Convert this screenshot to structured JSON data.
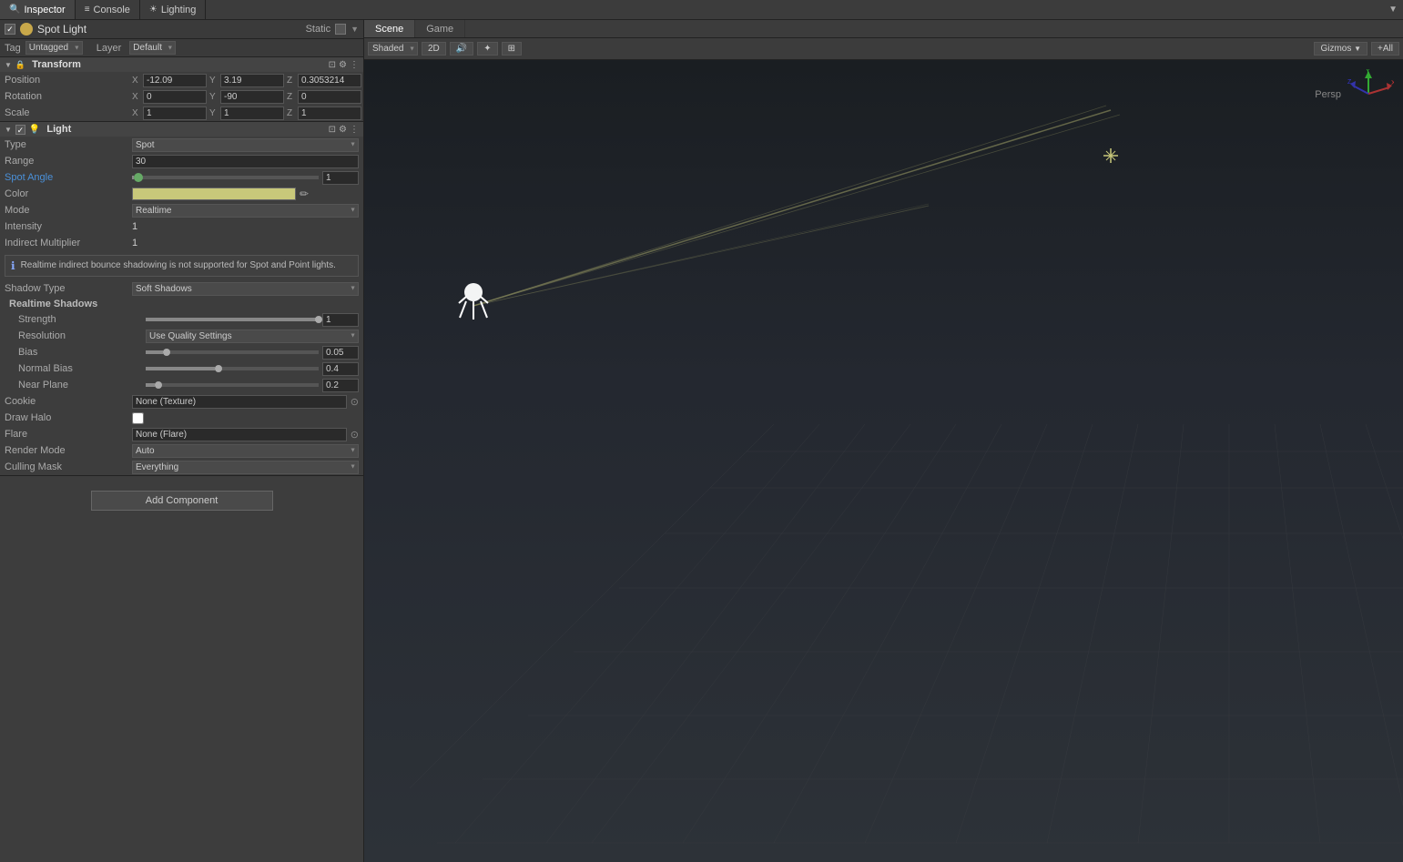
{
  "inspector_tab": "Inspector",
  "console_tab": "Console",
  "lighting_tab": "Lighting",
  "object": {
    "name": "Spot Light",
    "static_label": "Static",
    "tag": "Untagged",
    "layer": "Default"
  },
  "transform": {
    "title": "Transform",
    "position_label": "Position",
    "pos_x": "-12.09",
    "pos_y": "3.19",
    "pos_z": "0.3053214",
    "rotation_label": "Rotation",
    "rot_x": "0",
    "rot_y": "-90",
    "rot_z": "0",
    "scale_label": "Scale",
    "scale_x": "1",
    "scale_y": "1",
    "scale_z": "1"
  },
  "light": {
    "title": "Light",
    "type_label": "Type",
    "type_value": "Spot",
    "range_label": "Range",
    "range_value": "30",
    "spot_angle_label": "Spot Angle",
    "spot_angle_value": "1",
    "color_label": "Color",
    "mode_label": "Mode",
    "mode_value": "Realtime",
    "intensity_label": "Intensity",
    "intensity_value": "1",
    "indirect_mult_label": "Indirect Multiplier",
    "indirect_mult_value": "1",
    "info_text": "Realtime indirect bounce shadowing is not supported for Spot and Point lights.",
    "shadow_type_label": "Shadow Type",
    "shadow_type_value": "Soft Shadows",
    "realtime_shadows_label": "Realtime Shadows",
    "strength_label": "Strength",
    "strength_value": "1",
    "strength_pct": 100,
    "resolution_label": "Resolution",
    "resolution_value": "Use Quality Settings",
    "bias_label": "Bias",
    "bias_value": "0.05",
    "bias_pct": 10,
    "normal_bias_label": "Normal Bias",
    "normal_bias_value": "0.4",
    "normal_bias_pct": 40,
    "near_plane_label": "Near Plane",
    "near_plane_value": "0.2",
    "near_plane_pct": 5,
    "cookie_label": "Cookie",
    "cookie_value": "None (Texture)",
    "draw_halo_label": "Draw Halo",
    "flare_label": "Flare",
    "flare_value": "None (Flare)",
    "render_mode_label": "Render Mode",
    "render_mode_value": "Auto",
    "culling_mask_label": "Culling Mask",
    "culling_mask_value": "Everything"
  },
  "add_component_label": "Add Component",
  "scene": {
    "tab_scene": "Scene",
    "tab_game": "Game",
    "shading_mode": "Shaded",
    "gizmos_label": "Gizmos",
    "all_label": "+All",
    "persp_label": "Persp"
  }
}
